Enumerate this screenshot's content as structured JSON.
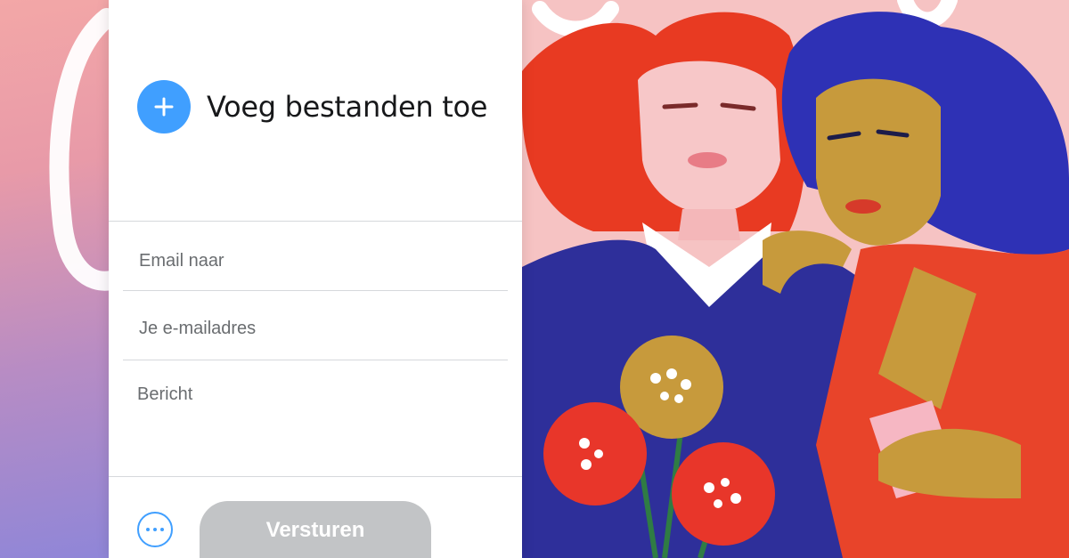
{
  "upload": {
    "label": "Voeg bestanden toe",
    "icon": "plus-icon"
  },
  "form": {
    "email_to_placeholder": "Email naar",
    "email_from_placeholder": "Je e-mailadres",
    "message_placeholder": "Bericht"
  },
  "actions": {
    "more_icon": "ellipsis-icon",
    "send_label": "Versturen"
  },
  "colors": {
    "accent": "#409fff",
    "send_disabled": "#c2c4c6",
    "background_pink": "#f6c3c3"
  }
}
